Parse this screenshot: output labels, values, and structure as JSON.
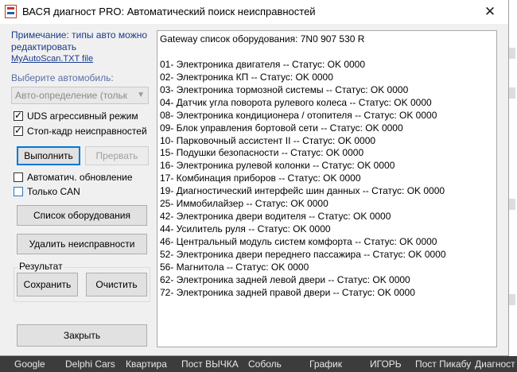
{
  "window": {
    "title": "ВАСЯ диагност PRO:  Автоматический поиск неисправностей",
    "close_glyph": "✕"
  },
  "left": {
    "note": "Примечание: типы авто можно редактировать",
    "note_link": "MyAutoScan.TXT file",
    "select_label": "Выберите автомобиль:",
    "select_value": "Авто-определение (тольк",
    "uds_label": "UDS агрессивный режим",
    "uds_checked": true,
    "freeze_label": "Стоп-кадр неисправностей",
    "freeze_checked": true,
    "run_label": "Выполнить",
    "abort_label": "Прервать",
    "autoupdate_label": "Автоматич. обновление",
    "autoupdate_checked": false,
    "canonly_label": "Только CAN",
    "canonly_checked": false,
    "equipment_list_label": "Список оборудования",
    "clear_faults_label": "Удалить неисправности",
    "result_group_label": "Результат",
    "save_label": "Сохранить",
    "clear_label": "Очистить",
    "close_label": "Закрыть"
  },
  "output": {
    "lines": [
      "Gateway список оборудования:  7N0 907 530 R",
      "",
      "01- Электроника двигателя -- Статус: OK 0000",
      "02- Электроника КП -- Статус: OK 0000",
      "03- Электроника тормозной системы -- Статус: OK 0000",
      "04- Датчик угла поворота рулевого колеса -- Статус: OK 0000",
      "08- Электроника кондиционера / отопителя -- Статус: OK 0000",
      "09- Блок управления бортовой сети -- Статус: OK 0000",
      "10- Парковочный ассистент II -- Статус: OK 0000",
      "15- Подушки безопасности -- Статус: OK 0000",
      "16- Электроника рулевой колонки -- Статус: OK 0000",
      "17- Комбинация приборов -- Статус: OK 0000",
      "19- Диагностический интерфейс шин данных -- Статус: OK 0000",
      "25- Иммобилайзер -- Статус: OK 0000",
      "42- Электроника двери водителя -- Статус: OK 0000",
      "44- Усилитель руля -- Статус: OK 0000",
      "46- Центральный модуль систем комфорта -- Статус: OK 0000",
      "52- Электроника двери переднего пассажира -- Статус: OK 0000",
      "56- Магнитола -- Статус: OK 0000",
      "62- Электроника задней левой двери -- Статус: OK 0000",
      "72- Электроника задней правой двери -- Статус: OK 0000"
    ]
  },
  "bookmarks": [
    "Google",
    "Delphi Cars",
    "Квартира",
    "Пост ВЫЧКА",
    "Соболь",
    "График",
    "ИГОРЬ",
    "Пост Пикабу",
    "Диагност"
  ]
}
